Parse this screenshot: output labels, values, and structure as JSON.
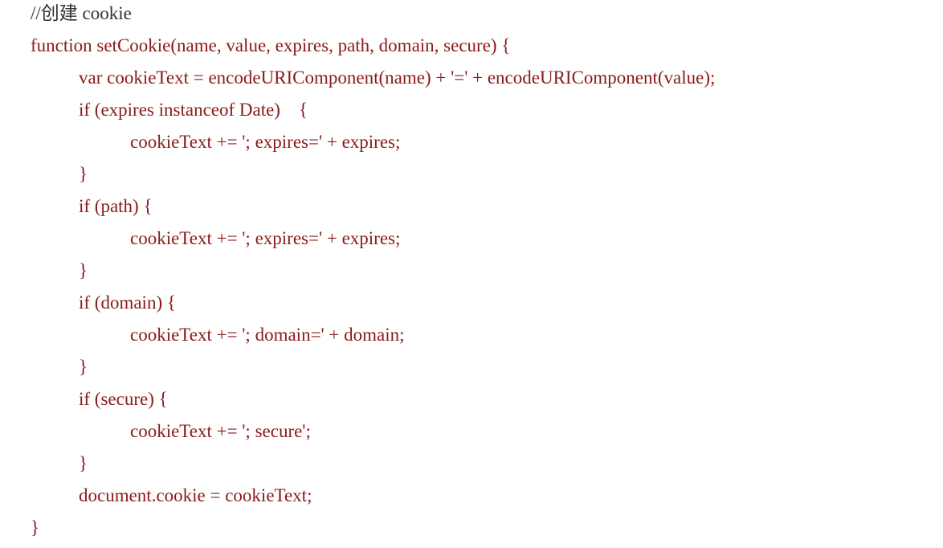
{
  "colors": {
    "code_text": "#8b1a1a",
    "comment_text": "#333333",
    "background": "#ffffff"
  },
  "code": {
    "lines": [
      "//创建 cookie",
      "function setCookie(name, value, expires, path, domain, secure) {",
      "var cookieText = encodeURIComponent(name) + '=' + encodeURIComponent(value);",
      "if (expires instanceof Date)    {",
      "cookieText += '; expires=' + expires;",
      "}",
      "if (path) {",
      "cookieText += '; expires=' + expires;",
      "}",
      "if (domain) {",
      "cookieText += '; domain=' + domain;",
      "}",
      "if (secure) {",
      "cookieText += '; secure';",
      "}",
      "document.cookie = cookieText;",
      "}"
    ]
  }
}
